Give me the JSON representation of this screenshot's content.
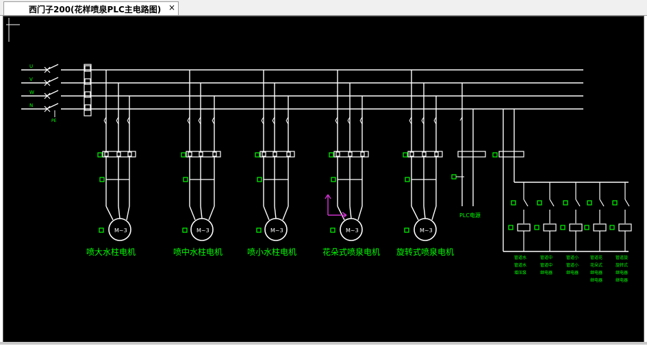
{
  "tab": {
    "title": "西门子200(花样喷泉PLC主电路图)",
    "close_label": "×"
  },
  "phases": [
    "U",
    "V",
    "W",
    "N"
  ],
  "pe_label": "PE",
  "motor_label": "M~3",
  "motors": [
    {
      "label": "喷大水柱电机"
    },
    {
      "label": "喷中水柱电机"
    },
    {
      "label": "喷小水柱电机"
    },
    {
      "label": "花朵式喷泉电机"
    },
    {
      "label": "旋转式喷泉电机"
    }
  ],
  "plc_label": "PLC电源",
  "relay_labels": [
    [
      "管道水",
      "管道水",
      "增压泵"
    ],
    [
      "管道中",
      "管道中",
      "继电器"
    ],
    [
      "管道小",
      "管道小",
      "继电器"
    ],
    [
      "管道花",
      "花朵式",
      "继电器",
      "继电器"
    ],
    [
      "管道旋",
      "旋转式",
      "继电器",
      "继电器"
    ]
  ],
  "colors": {
    "wire": "#ffffff",
    "label": "#00ff00",
    "marker": "#cc33cc",
    "background": "#000000"
  }
}
